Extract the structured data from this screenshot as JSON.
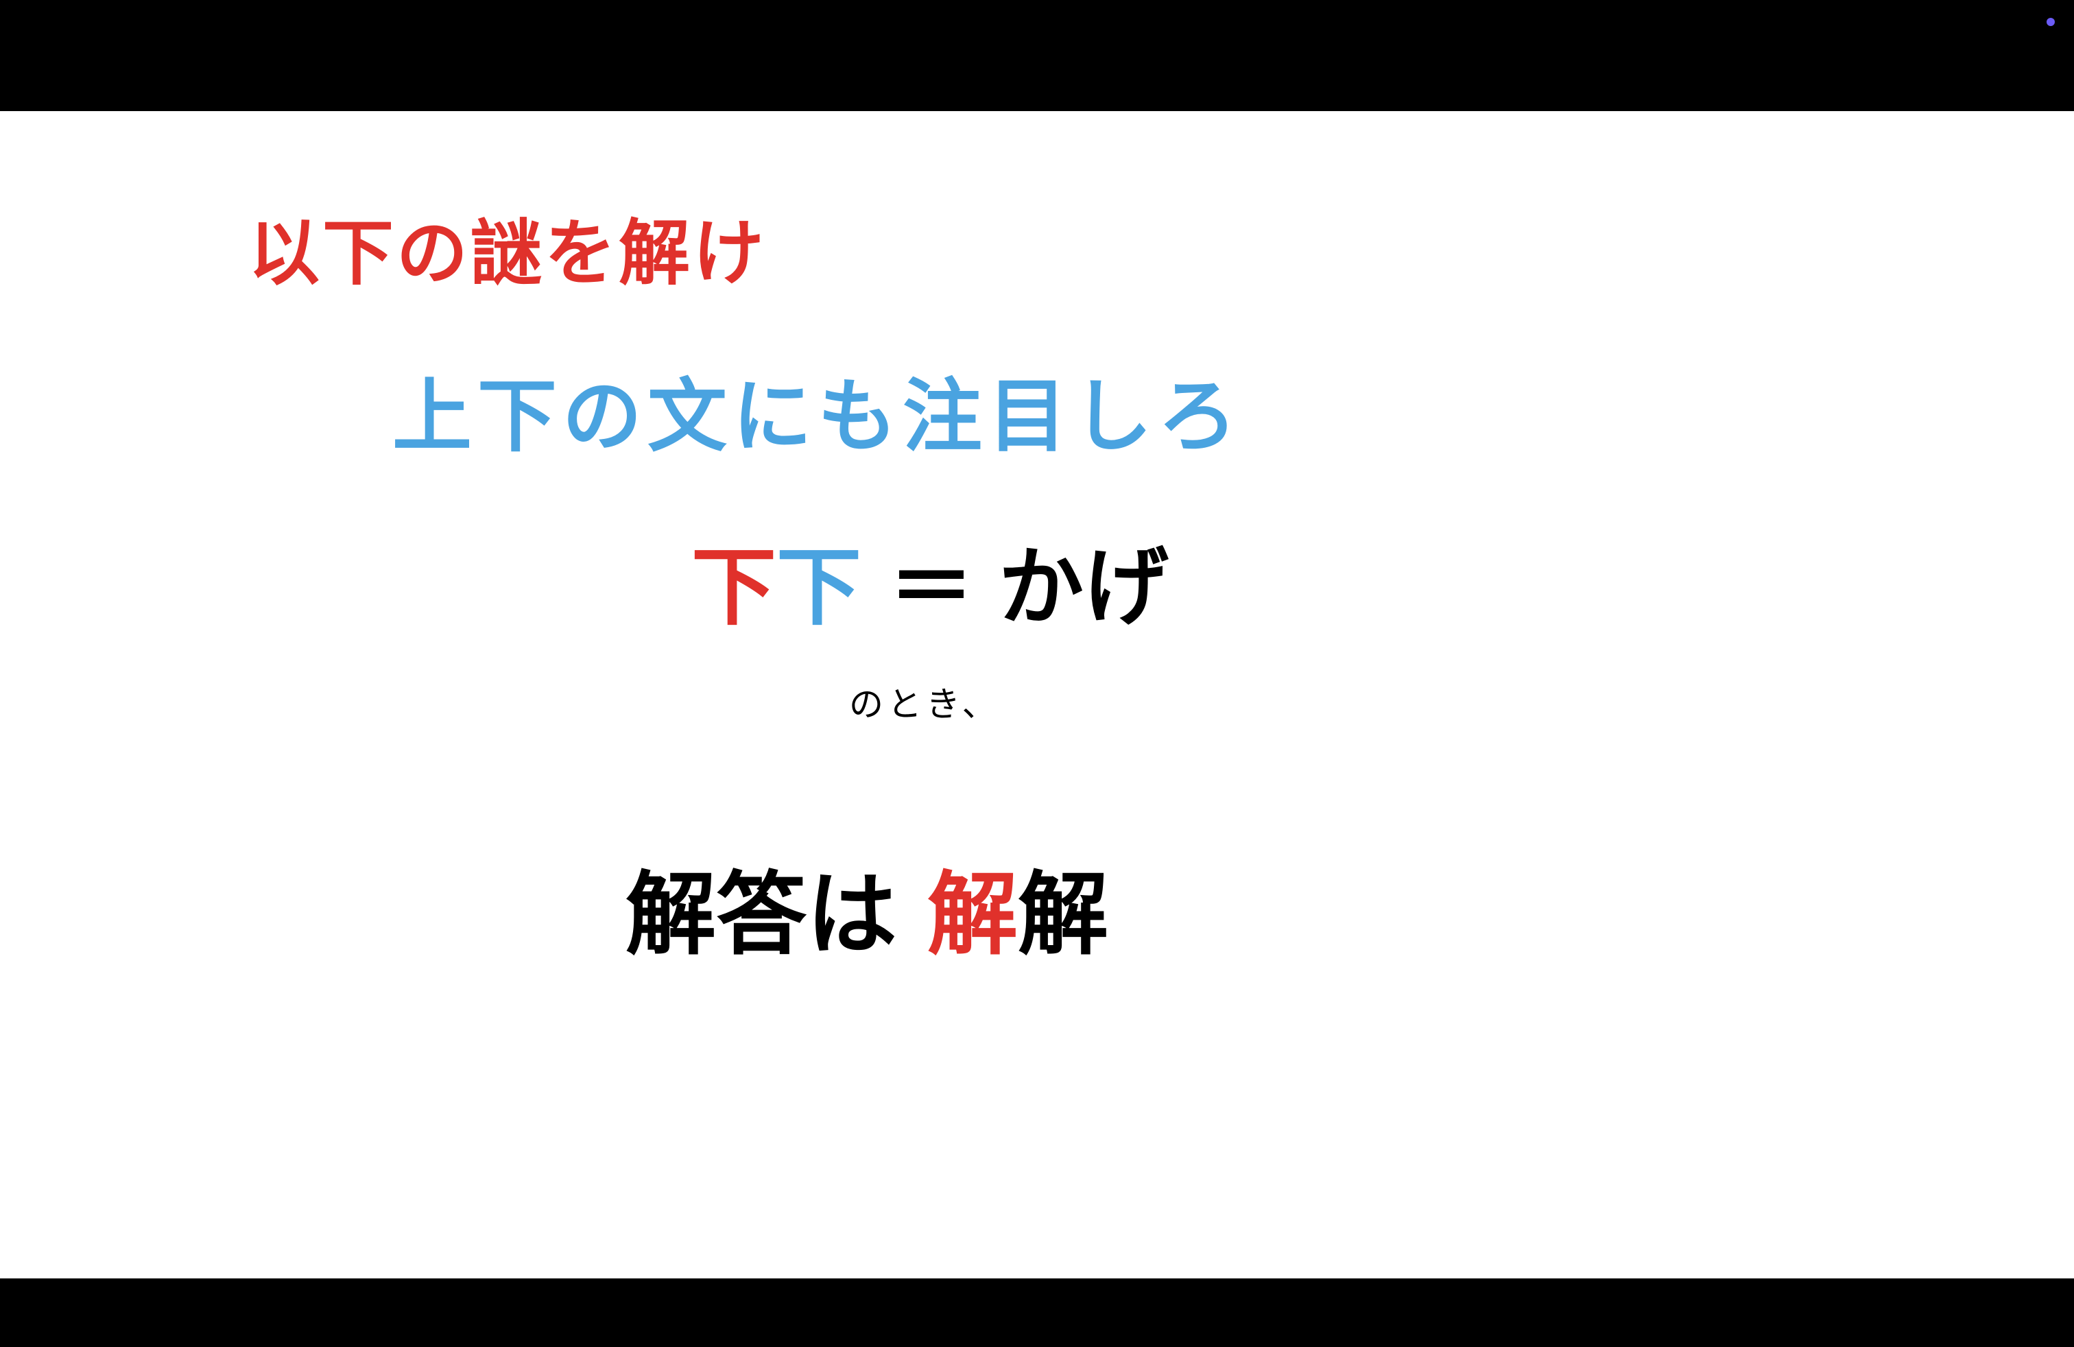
{
  "colors": {
    "red": "#e0312b",
    "blue": "#4aa3e0",
    "black": "#000000",
    "indicator": "#6b5cf6"
  },
  "slide": {
    "instruction": "以下の謎を解け",
    "hint": "上下の文にも注目しろ",
    "equation": {
      "left_char_red": "下",
      "left_char_blue": "下",
      "equals": "＝",
      "right": "かげ"
    },
    "caption": "のとき、",
    "answer": {
      "prefix": "解答は",
      "char_red": "解",
      "char_black": "解"
    }
  }
}
